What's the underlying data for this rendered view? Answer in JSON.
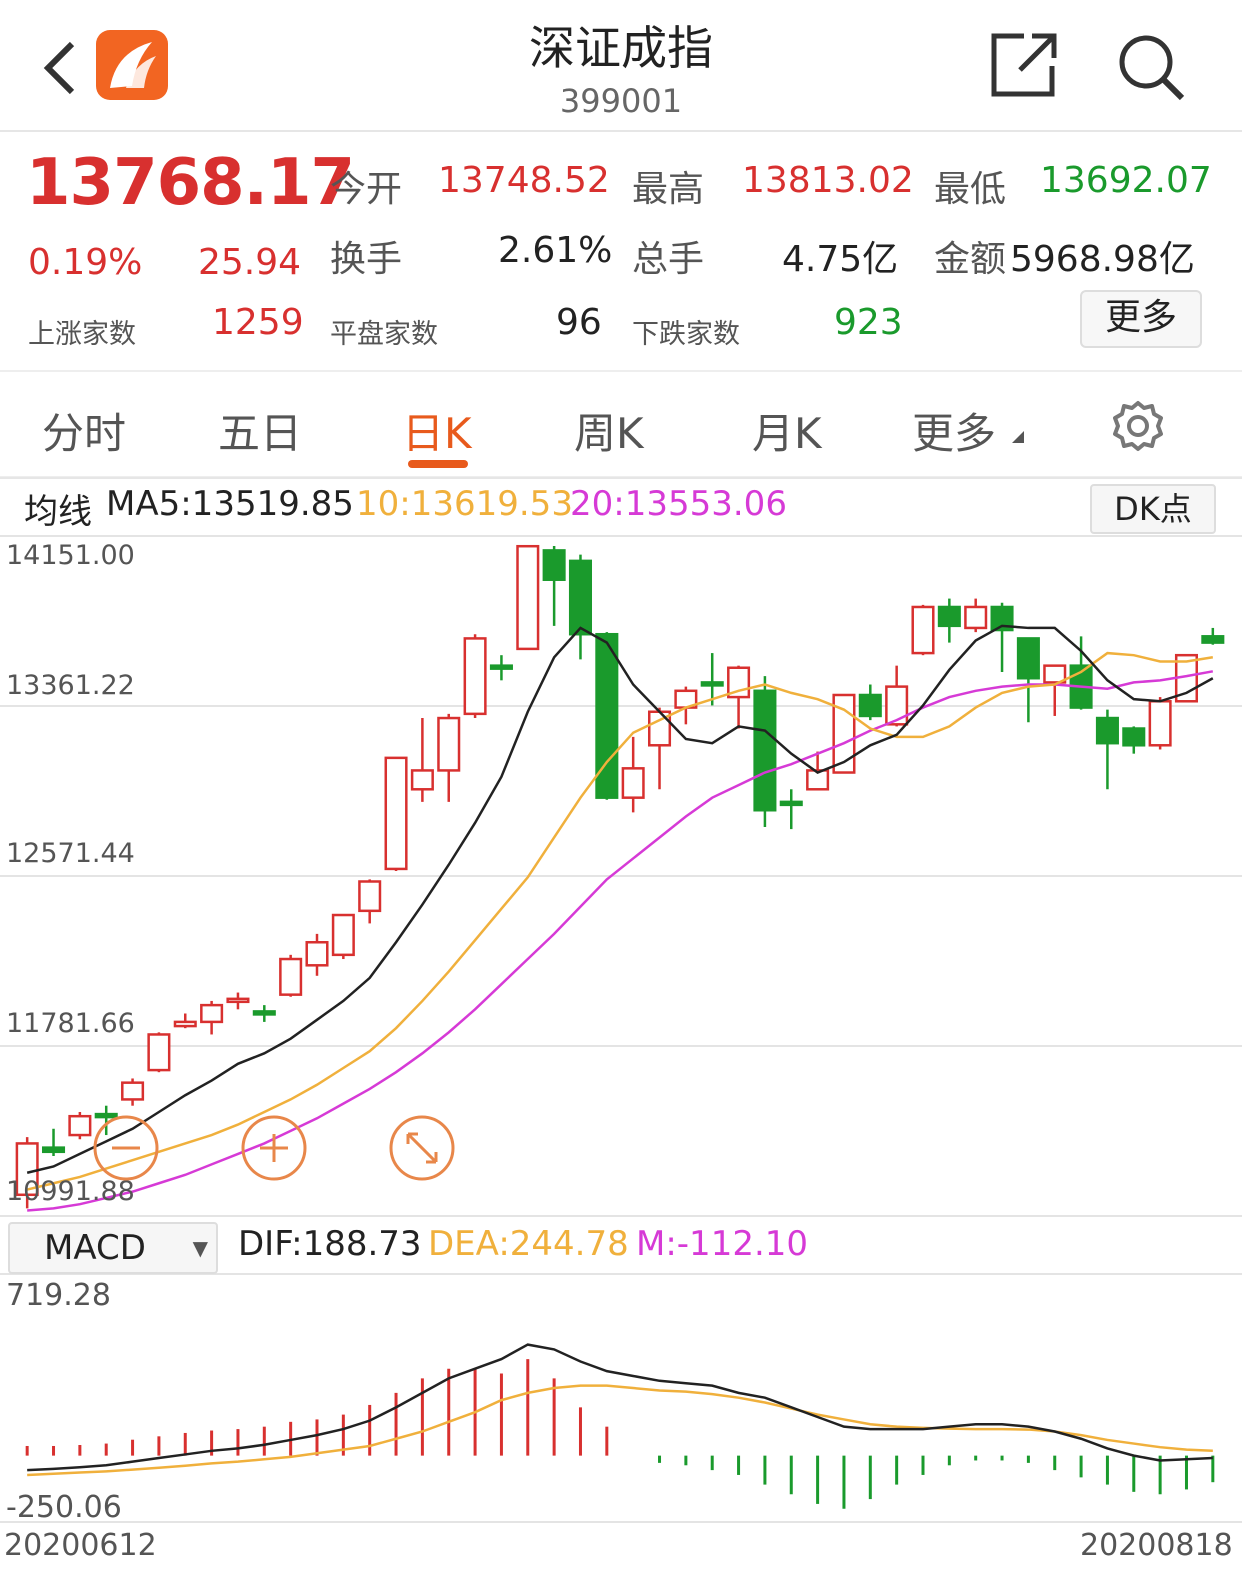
{
  "header": {
    "title": "深证成指",
    "code": "399001"
  },
  "quote": {
    "price": "13768.17",
    "change_pct": "0.19%",
    "change": "25.94",
    "open_label": "今开",
    "open": "13748.52",
    "high_label": "最高",
    "high": "13813.02",
    "low_label": "最低",
    "low": "13692.07",
    "turnover_label": "换手",
    "turnover": "2.61%",
    "volume_label": "总手",
    "volume": "4.75亿",
    "amount_label": "金额",
    "amount": "5968.98亿",
    "up_label": "上涨家数",
    "up": "1259",
    "flat_label": "平盘家数",
    "flat": "96",
    "down_label": "下跌家数",
    "down": "923",
    "more": "更多"
  },
  "tabs": [
    "分时",
    "五日",
    "日K",
    "周K",
    "月K",
    "更多"
  ],
  "active_tab": "日K",
  "ma": {
    "label": "均线",
    "ma5": "MA5:13519.85",
    "ma10": "10:13619.53",
    "ma20": "20:13553.06",
    "dk": "DK点"
  },
  "main_axis": [
    "14151.00",
    "13361.22",
    "12571.44",
    "11781.66",
    "10991.88"
  ],
  "macd": {
    "select": "MACD",
    "dif": "DIF:188.73",
    "dea": "DEA:244.78",
    "m": "M:-112.10",
    "axis_top": "719.28",
    "axis_bottom": "-250.06"
  },
  "dates": {
    "start": "20200612",
    "end": "20200818"
  },
  "icons": [
    "back-icon",
    "app-logo-icon",
    "share-icon",
    "search-icon",
    "settings-icon",
    "zoom-out-icon",
    "zoom-in-icon",
    "expand-icon"
  ],
  "colors": {
    "up": "#d8302f",
    "down": "#1a9a2c",
    "ma5": "#222222",
    "ma10": "#f0b03c",
    "ma20": "#d63ad6",
    "accent": "#e85a1c"
  },
  "chart_data": {
    "type": "candlestick",
    "x": [
      "20200612",
      "20200818"
    ],
    "ylim": [
      10991.88,
      14151.0
    ],
    "candles": [
      {
        "o": 11055,
        "c": 11300,
        "h": 11330,
        "l": 10990
      },
      {
        "o": 11280,
        "c": 11260,
        "h": 11370,
        "l": 11240
      },
      {
        "o": 11340,
        "c": 11430,
        "h": 11450,
        "l": 11320
      },
      {
        "o": 11440,
        "c": 11430,
        "h": 11480,
        "l": 11340
      },
      {
        "o": 11510,
        "c": 11590,
        "h": 11610,
        "l": 11480
      },
      {
        "o": 11650,
        "c": 11820,
        "h": 11830,
        "l": 11640
      },
      {
        "o": 11860,
        "c": 11880,
        "h": 11920,
        "l": 11850
      },
      {
        "o": 11880,
        "c": 11960,
        "h": 11980,
        "l": 11820
      },
      {
        "o": 11980,
        "c": 11990,
        "h": 12020,
        "l": 11940
      },
      {
        "o": 11930,
        "c": 11920,
        "h": 11960,
        "l": 11880
      },
      {
        "o": 12010,
        "c": 12180,
        "h": 12200,
        "l": 12000
      },
      {
        "o": 12150,
        "c": 12260,
        "h": 12300,
        "l": 12100
      },
      {
        "o": 12200,
        "c": 12390,
        "h": 12390,
        "l": 12180
      },
      {
        "o": 12410,
        "c": 12550,
        "h": 12560,
        "l": 12350
      },
      {
        "o": 12610,
        "c": 13140,
        "h": 13140,
        "l": 12600
      },
      {
        "o": 12990,
        "c": 13080,
        "h": 13330,
        "l": 12930
      },
      {
        "o": 13080,
        "c": 13330,
        "h": 13350,
        "l": 12930
      },
      {
        "o": 13350,
        "c": 13710,
        "h": 13730,
        "l": 13330
      },
      {
        "o": 13580,
        "c": 13570,
        "h": 13630,
        "l": 13510
      },
      {
        "o": 13660,
        "c": 14150,
        "h": 14150,
        "l": 13660
      },
      {
        "o": 14130,
        "c": 13990,
        "h": 14151,
        "l": 13770
      },
      {
        "o": 14080,
        "c": 13730,
        "h": 14110,
        "l": 13610
      },
      {
        "o": 13730,
        "c": 12950,
        "h": 13740,
        "l": 12940
      },
      {
        "o": 12950,
        "c": 13090,
        "h": 13240,
        "l": 12880
      },
      {
        "o": 13200,
        "c": 13360,
        "h": 13380,
        "l": 12990
      },
      {
        "o": 13380,
        "c": 13460,
        "h": 13480,
        "l": 13300
      },
      {
        "o": 13500,
        "c": 13490,
        "h": 13640,
        "l": 13390
      },
      {
        "o": 13430,
        "c": 13570,
        "h": 13580,
        "l": 13280
      },
      {
        "o": 13460,
        "c": 12890,
        "h": 13530,
        "l": 12810
      },
      {
        "o": 12930,
        "c": 12920,
        "h": 12990,
        "l": 12800
      },
      {
        "o": 12990,
        "c": 13080,
        "h": 13170,
        "l": 12990
      },
      {
        "o": 13070,
        "c": 13440,
        "h": 13440,
        "l": 13070
      },
      {
        "o": 13440,
        "c": 13340,
        "h": 13490,
        "l": 13320
      },
      {
        "o": 13300,
        "c": 13480,
        "h": 13580,
        "l": 13290
      },
      {
        "o": 13640,
        "c": 13860,
        "h": 13870,
        "l": 13630
      },
      {
        "o": 13860,
        "c": 13770,
        "h": 13900,
        "l": 13690
      },
      {
        "o": 13760,
        "c": 13860,
        "h": 13900,
        "l": 13740
      },
      {
        "o": 13860,
        "c": 13750,
        "h": 13880,
        "l": 13550
      },
      {
        "o": 13710,
        "c": 13520,
        "h": 13710,
        "l": 13310
      },
      {
        "o": 13500,
        "c": 13580,
        "h": 13580,
        "l": 13340
      },
      {
        "o": 13580,
        "c": 13380,
        "h": 13720,
        "l": 13370
      },
      {
        "o": 13330,
        "c": 13210,
        "h": 13370,
        "l": 12990
      },
      {
        "o": 13280,
        "c": 13200,
        "h": 13290,
        "l": 13160
      },
      {
        "o": 13200,
        "c": 13410,
        "h": 13430,
        "l": 13180
      },
      {
        "o": 13410,
        "c": 13630,
        "h": 13630,
        "l": 13410
      },
      {
        "o": 13720,
        "c": 13690,
        "h": 13760,
        "l": 13680
      }
    ],
    "ma5": [
      11160,
      11190,
      11250,
      11310,
      11370,
      11450,
      11530,
      11600,
      11680,
      11730,
      11800,
      11890,
      11980,
      12090,
      12260,
      12440,
      12630,
      12830,
      13050,
      13360,
      13620,
      13760,
      13690,
      13490,
      13360,
      13230,
      13210,
      13290,
      13270,
      13160,
      13070,
      13120,
      13200,
      13250,
      13390,
      13560,
      13700,
      13770,
      13760,
      13760,
      13650,
      13510,
      13420,
      13410,
      13450,
      13520
    ],
    "ma10": [
      11080,
      11110,
      11140,
      11180,
      11220,
      11260,
      11300,
      11340,
      11390,
      11450,
      11510,
      11580,
      11660,
      11740,
      11850,
      11980,
      12120,
      12270,
      12420,
      12570,
      12760,
      12950,
      13120,
      13260,
      13320,
      13380,
      13420,
      13460,
      13490,
      13450,
      13420,
      13370,
      13280,
      13240,
      13240,
      13290,
      13380,
      13450,
      13480,
      13490,
      13550,
      13640,
      13630,
      13600,
      13600,
      13620
    ],
    "ma20": [
      10980,
      10990,
      11010,
      11040,
      11070,
      11110,
      11150,
      11200,
      11250,
      11300,
      11360,
      11420,
      11490,
      11560,
      11640,
      11730,
      11830,
      11940,
      12060,
      12180,
      12300,
      12430,
      12560,
      12660,
      12760,
      12860,
      12950,
      13010,
      13070,
      13110,
      13160,
      13210,
      13270,
      13320,
      13380,
      13430,
      13460,
      13480,
      13490,
      13490,
      13480,
      13470,
      13500,
      13510,
      13530,
      13553
    ],
    "dif": [
      -60,
      -55,
      -48,
      -40,
      -25,
      -10,
      5,
      20,
      30,
      45,
      65,
      85,
      110,
      145,
      200,
      260,
      320,
      360,
      400,
      460,
      440,
      390,
      350,
      330,
      310,
      300,
      290,
      260,
      240,
      200,
      160,
      120,
      110,
      110,
      110,
      120,
      130,
      130,
      120,
      100,
      70,
      30,
      0,
      -20,
      -15,
      -10
    ],
    "dea": [
      -80,
      -75,
      -70,
      -65,
      -58,
      -50,
      -42,
      -32,
      -25,
      -15,
      -5,
      10,
      25,
      40,
      70,
      100,
      140,
      180,
      230,
      260,
      280,
      290,
      290,
      280,
      270,
      265,
      255,
      240,
      220,
      195,
      170,
      150,
      130,
      120,
      115,
      112,
      110,
      110,
      108,
      100,
      85,
      65,
      50,
      35,
      25,
      20
    ],
    "macd_hist": [
      40,
      40,
      44,
      50,
      66,
      80,
      94,
      104,
      110,
      120,
      140,
      150,
      170,
      210,
      260,
      320,
      360,
      360,
      340,
      400,
      320,
      200,
      120,
      0,
      -30,
      -40,
      -60,
      -80,
      -120,
      -160,
      -200,
      -220,
      -180,
      -120,
      -80,
      -40,
      -20,
      -20,
      -30,
      -60,
      -90,
      -120,
      -150,
      -160,
      -140,
      -110
    ]
  }
}
